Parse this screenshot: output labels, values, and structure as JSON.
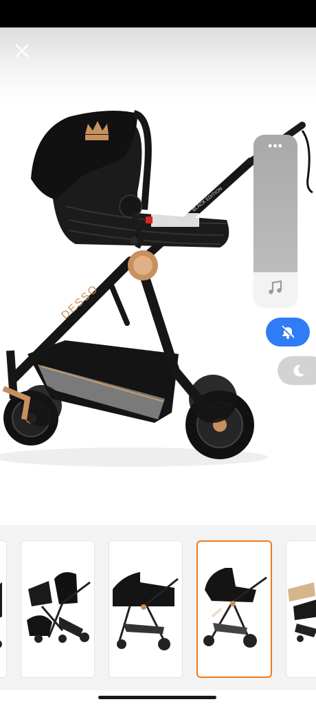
{
  "screen": {
    "hint": "Product image viewer with overlay controls"
  },
  "product_image": {
    "frame_text": "DESSO",
    "label_text": "BLACK EDITION",
    "brand_color": "#b8865a"
  },
  "controls": {
    "close_icon": "close-icon",
    "more_icon": "more-dots-icon",
    "more_glyph": "•••",
    "music_icon": "music-note-icon",
    "mute_icon": "bell-slash-icon",
    "dnd_icon": "moon-icon",
    "accent": "#2f7cf6"
  },
  "thumbnails": {
    "selected_index": 3,
    "selected_color": "#f07a18",
    "items": [
      {
        "icon": "stroller-partial-thumbnail"
      },
      {
        "icon": "stroller-set-thumbnail"
      },
      {
        "icon": "stroller-bassinet-thumbnail"
      },
      {
        "icon": "stroller-carseat-thumbnail"
      },
      {
        "icon": "stroller-seat-partial-thumbnail"
      }
    ]
  }
}
